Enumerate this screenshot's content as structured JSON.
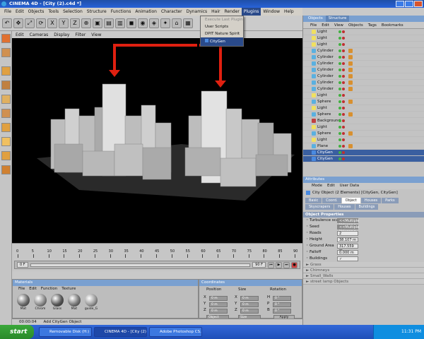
{
  "window": {
    "title": "CINEMA 4D - [City (2).c4d *]"
  },
  "menubar": [
    "File",
    "Edit",
    "Objects",
    "Tools",
    "Selection",
    "Structure",
    "Functions",
    "Animation",
    "Character",
    "Dynamics",
    "Hair",
    "Render",
    "Plugins",
    "Window",
    "Help"
  ],
  "plugins_menu": {
    "items": [
      "Execute Last Plugin",
      "User Scripts",
      "DPIT Nature Spirit",
      "CityGen"
    ]
  },
  "viewport_menu": [
    "Edit",
    "Cameras",
    "Display",
    "Filter",
    "View"
  ],
  "object_manager": {
    "tabs": [
      "Objects",
      "Structure"
    ],
    "menu": [
      "File",
      "Edit",
      "View",
      "Objects",
      "Tags",
      "Bookmarks"
    ],
    "rows": [
      {
        "name": "Light"
      },
      {
        "name": "Light"
      },
      {
        "name": "Light"
      },
      {
        "name": "Cylinder"
      },
      {
        "name": "Cylinder"
      },
      {
        "name": "Cylinder"
      },
      {
        "name": "Cylinder"
      },
      {
        "name": "Cylinder"
      },
      {
        "name": "Cylinder"
      },
      {
        "name": "Cylinder"
      },
      {
        "name": "Light"
      },
      {
        "name": "Sphere"
      },
      {
        "name": "Light"
      },
      {
        "name": "Sphere"
      },
      {
        "name": "Background"
      },
      {
        "name": "Light"
      },
      {
        "name": "Sphere"
      },
      {
        "name": "Light"
      },
      {
        "name": "Plane"
      },
      {
        "name": "CityGen"
      },
      {
        "name": "CityGen"
      }
    ]
  },
  "attributes": {
    "header": "Attributes",
    "menu": [
      "Mode",
      "Edit",
      "User Data"
    ],
    "object_title": "City Object (2 Elements) [CityGen, CityGen]",
    "tabs": [
      "Basic",
      "Coord.",
      "Object",
      "Houses",
      "Parks",
      "Skyscrapers",
      "Houses",
      "Buildings"
    ],
    "section": "Object Properties",
    "props": [
      {
        "label": "Turbulence scale",
        "value": "<<Multiple Values>>",
        "drop": true
      },
      {
        "label": "Seed",
        "value": "<<Multiple Values>>",
        "drop": true
      },
      {
        "label": "Roads",
        "value": "2",
        "drop": false
      },
      {
        "label": "Height",
        "value": "38.107 m",
        "drop": false
      },
      {
        "label": "Ground Area",
        "value": "317.559 m",
        "drop": false
      },
      {
        "label": "Falloff",
        "value": "0.000 m",
        "drop": false
      },
      {
        "label": "Buildings",
        "value": "✓",
        "drop": false
      }
    ],
    "groups": [
      "Grass",
      "Chimneys",
      "Small_Walls",
      "street lamp Objects"
    ]
  },
  "timeline": {
    "ticks": [
      "0",
      "5",
      "10",
      "15",
      "20",
      "25",
      "30",
      "35",
      "40",
      "45",
      "50",
      "55",
      "60",
      "65",
      "70",
      "75",
      "80",
      "85",
      "90"
    ],
    "frame_left": "0 F",
    "frame_right": "90 F"
  },
  "materials": {
    "header": "Materials",
    "menu": [
      "File",
      "Edit",
      "Function",
      "Texture"
    ],
    "swatches": [
      {
        "label": "Mat",
        "color": "#6a6a6a"
      },
      {
        "label": "Chrom",
        "color": "#8a8a8a"
      },
      {
        "label": "Glass",
        "color": "#555"
      },
      {
        "label": "Mat",
        "color": "#777"
      },
      {
        "label": "guide_G",
        "color": "#999"
      }
    ]
  },
  "coordinates": {
    "header": "Coordinates",
    "position_label": "Position",
    "size_label": "Size",
    "rotation_label": "Rotation",
    "rows": [
      {
        "axis": "X",
        "val": "0 m",
        "axis2": "X",
        "val2": "0 m",
        "axis3": "H",
        "val3": "0 °"
      },
      {
        "axis": "Y",
        "val": "0 m",
        "axis2": "Y",
        "val2": "0 m",
        "axis3": "P",
        "val3": "0 °"
      },
      {
        "axis": "Z",
        "val": "0 m",
        "axis2": "Z",
        "val2": "0 m",
        "axis3": "B",
        "val3": "0 °"
      }
    ],
    "mode": "Object",
    "size_mode": "Size",
    "apply_label": "Apply"
  },
  "status": {
    "time": "00:00:04",
    "message": "Add CityGen Object"
  },
  "taskbar": {
    "start_label": "start",
    "tasks": [
      {
        "label": "Removable Disk (H:)",
        "active": false
      },
      {
        "label": "CINEMA 4D - [City (2)...",
        "active": true
      },
      {
        "label": "Adobe Photoshop CS...",
        "active": false
      }
    ],
    "clock": "11:31 PM"
  },
  "colors": {
    "accent": "#2862d8",
    "selection": "#3a5fa0",
    "arrow": "#e02010"
  }
}
